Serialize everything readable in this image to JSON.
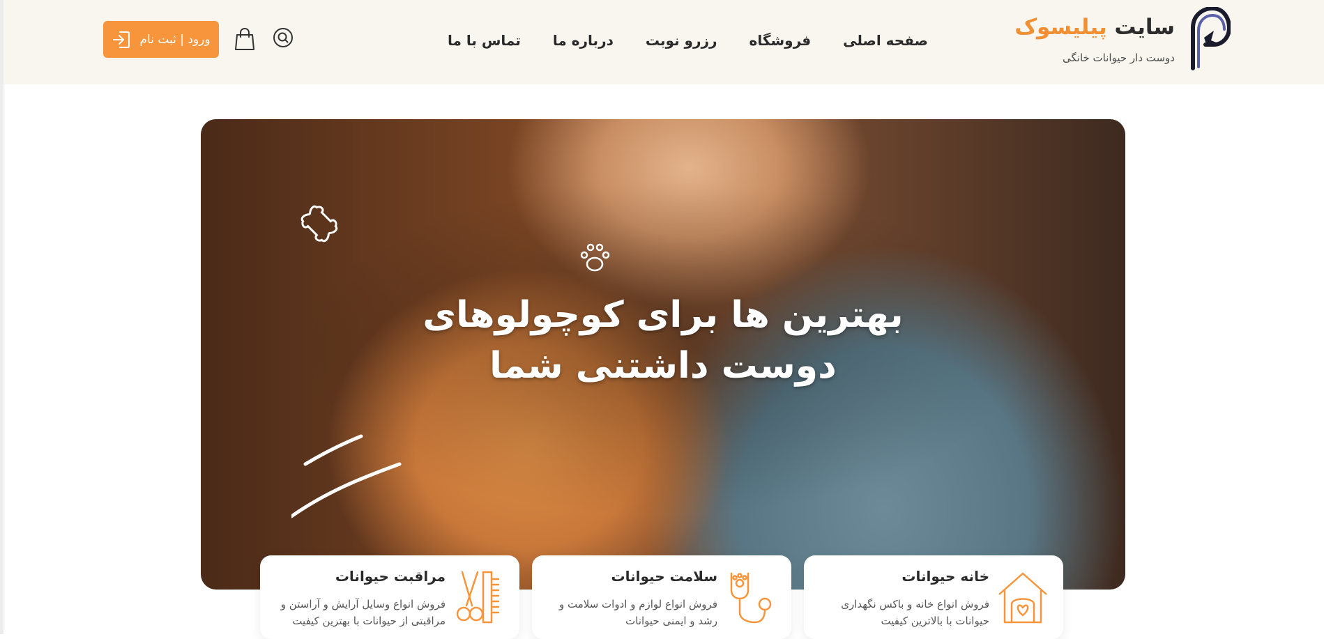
{
  "site": {
    "title_part1": "سایت ",
    "title_brand": "پیلیسوک",
    "subtitle": "دوست دار حیوانات خانگی"
  },
  "nav": {
    "items": [
      {
        "label": "صفحه اصلی"
      },
      {
        "label": "فروشگاه"
      },
      {
        "label": "رزرو نوبت"
      },
      {
        "label": "درباره ما"
      },
      {
        "label": "تماس با ما"
      }
    ]
  },
  "actions": {
    "login_label": "ورود | ثبت نام",
    "search_icon": "search-icon",
    "cart_icon": "shopping-bag-icon",
    "login_icon": "login-arrow-icon"
  },
  "hero": {
    "line1": "بهترین ها برای کوچولوهای",
    "line2": "دوست داشتنی شما"
  },
  "cards": [
    {
      "title": "خانه حیوانات",
      "desc": "فروش انواع خانه و باکس نگهداری حیوانات با بالاترین کیفیت",
      "icon": "pet-house-icon"
    },
    {
      "title": "سلامت حیوانات",
      "desc": "فروش انواع لوازم و ادوات سلامت و رشد و ایمنی حیوانات",
      "icon": "stethoscope-paw-icon"
    },
    {
      "title": "مراقبت حیوانات",
      "desc": "فروش انواع وسایل آرایش و آراستن و مراقبتی از حیوانات با بهترین کیفیت",
      "icon": "scissors-comb-icon"
    }
  ],
  "colors": {
    "accent": "#f7953c",
    "header_bg": "#f9f6f0",
    "text_dark": "#2a2a2a"
  }
}
